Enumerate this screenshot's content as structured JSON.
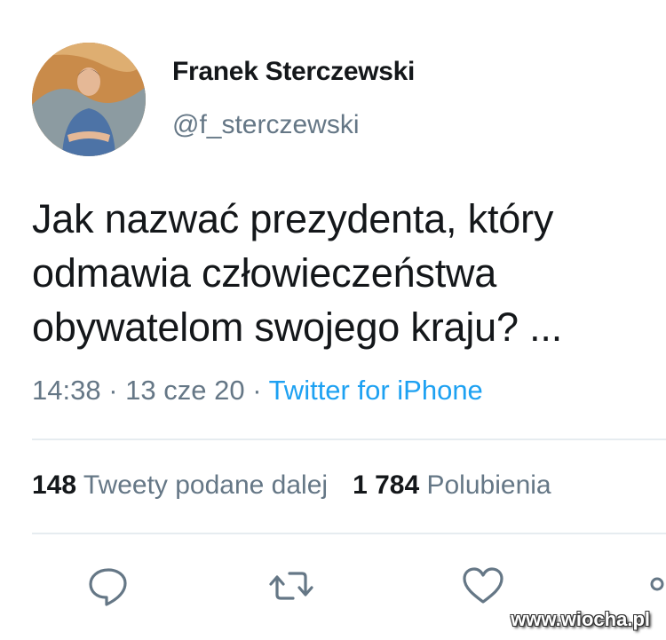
{
  "author": {
    "name": "Franek Sterczewski",
    "handle": "@f_sterczewski"
  },
  "tweet": {
    "lines": [
      "Jak nazwać prezydenta, który",
      "odmawia człowieczeństwa",
      "obywatelom swojego kraju? ..."
    ],
    "time": "14:38",
    "separator": " · ",
    "date": "13 cze 20",
    "source": "Twitter for iPhone"
  },
  "stats": {
    "retweets_count": "148",
    "retweets_label": "Tweety podane dalej",
    "likes_count": "1 784",
    "likes_label": "Polubienia"
  },
  "actions": {
    "reply_icon": "speech-bubble-icon",
    "retweet_icon": "retweet-arrows-icon",
    "like_icon": "heart-icon",
    "share_icon": "share-icon"
  },
  "colors": {
    "text": "#14171a",
    "secondary": "#657786",
    "link": "#1da1f2",
    "divider": "#e6ecf0"
  },
  "watermark": "www.wiocha.pl"
}
